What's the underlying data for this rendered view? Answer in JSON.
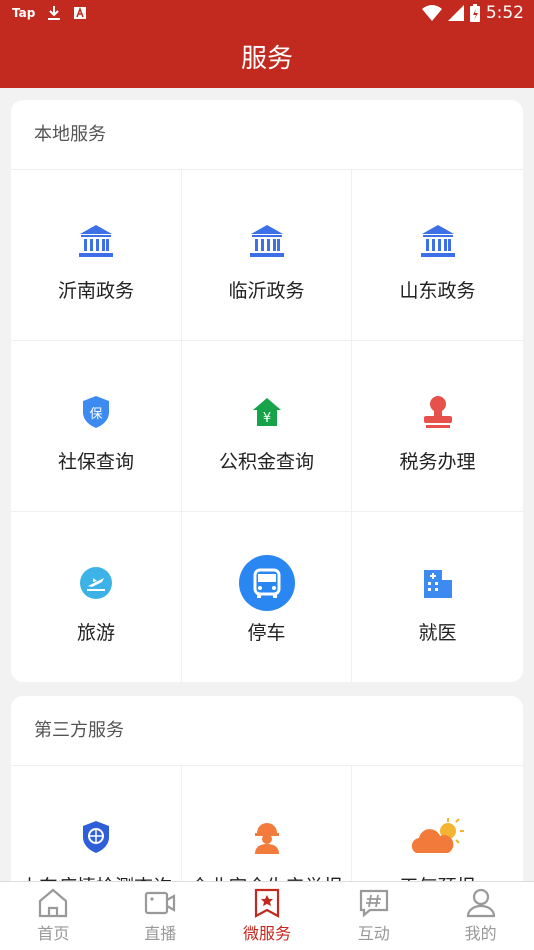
{
  "status": {
    "left": [
      "Tap"
    ],
    "time": "5:52"
  },
  "header": {
    "title": "服务"
  },
  "local": {
    "title": "本地服务",
    "items": [
      {
        "label": "沂南政务",
        "icon": "government-building-icon"
      },
      {
        "label": "临沂政务",
        "icon": "government-building-icon"
      },
      {
        "label": "山东政务",
        "icon": "government-building-icon"
      },
      {
        "label": "社保查询",
        "icon": "social-insurance-shield-icon"
      },
      {
        "label": "公积金查询",
        "icon": "housing-fund-house-icon"
      },
      {
        "label": "税务办理",
        "icon": "tax-stamp-icon"
      },
      {
        "label": "旅游",
        "icon": "travel-plane-icon"
      },
      {
        "label": "停车",
        "icon": "parking-bus-icon"
      },
      {
        "label": "就医",
        "icon": "hospital-building-icon"
      }
    ]
  },
  "third": {
    "title": "第三方服务",
    "items": [
      {
        "label": "山东疫情检测查询",
        "icon": "epidemic-shield-icon"
      },
      {
        "label": "企业安全生产举报",
        "icon": "worker-helmet-icon"
      },
      {
        "label": "天气预报",
        "icon": "weather-cloud-sun-icon"
      }
    ]
  },
  "tabs": [
    {
      "label": "首页",
      "icon": "home-icon"
    },
    {
      "label": "直播",
      "icon": "video-camera-icon"
    },
    {
      "label": "微服务",
      "icon": "service-bookmark-icon",
      "active": true
    },
    {
      "label": "互动",
      "icon": "hashtag-chat-icon"
    },
    {
      "label": "我的",
      "icon": "user-icon"
    }
  ],
  "colors": {
    "brand": "#c22a1f",
    "blue": "#3d6fe6",
    "green": "#17a34a",
    "red": "#e6524a",
    "orange": "#f27a3a"
  }
}
